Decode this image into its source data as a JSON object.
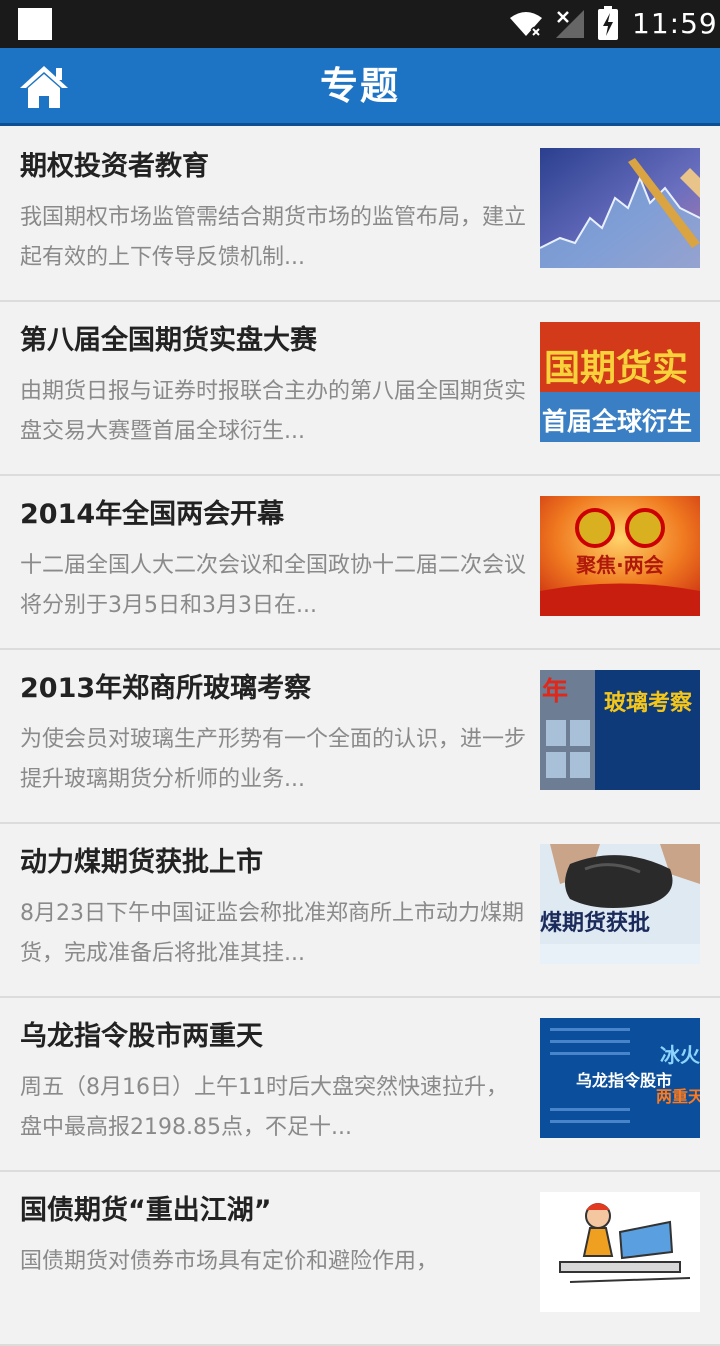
{
  "status_bar": {
    "time": "11:59"
  },
  "app_bar": {
    "title": "专题",
    "home_icon": "home-icon"
  },
  "topics": [
    {
      "title": "期权投资者教育",
      "summary": "我国期权市场监管需结合期货市场的监管布局，建立起有效的上下传导反馈机制..."
    },
    {
      "title": "第八届全国期货实盘大赛",
      "summary": "由期货日报与证券时报联合主办的第八届全国期货实盘交易大赛暨首届全球衍生...",
      "thumb_text": [
        "国期货实",
        "首届全球衍生"
      ]
    },
    {
      "title": "2014年全国两会开幕",
      "summary": "十二届全国人大二次会议和全国政协十二届二次会议将分别于3月5日和3月3日在...",
      "thumb_text": [
        "聚焦·两会"
      ]
    },
    {
      "title": "2013年郑商所玻璃考察",
      "summary": "为使会员对玻璃生产形势有一个全面的认识，进一步提升玻璃期货分析师的业务...",
      "thumb_text": [
        "年",
        "玻璃考察"
      ]
    },
    {
      "title": "动力煤期货获批上市",
      "summary": "8月23日下午中国证监会称批准郑商所上市动力煤期货，完成准备后将批准其挂...",
      "thumb_text": [
        "煤期货获批"
      ]
    },
    {
      "title": "乌龙指令股市两重天",
      "summary": "周五（8月16日）上午11时后大盘突然快速拉升，盘中最高报2198.85点，不足十...",
      "thumb_text": [
        "乌龙指令股市",
        "冰火",
        "两重天"
      ]
    },
    {
      "title": "国债期货“重出江湖”",
      "summary": "国债期货对债券市场具有定价和避险作用，"
    }
  ],
  "colors": {
    "app_bar": "#1d74c4",
    "status_bar": "#1a1a1a",
    "background": "#f2f2f2",
    "title_text": "#222222",
    "summary_text": "#8a8a8a"
  }
}
